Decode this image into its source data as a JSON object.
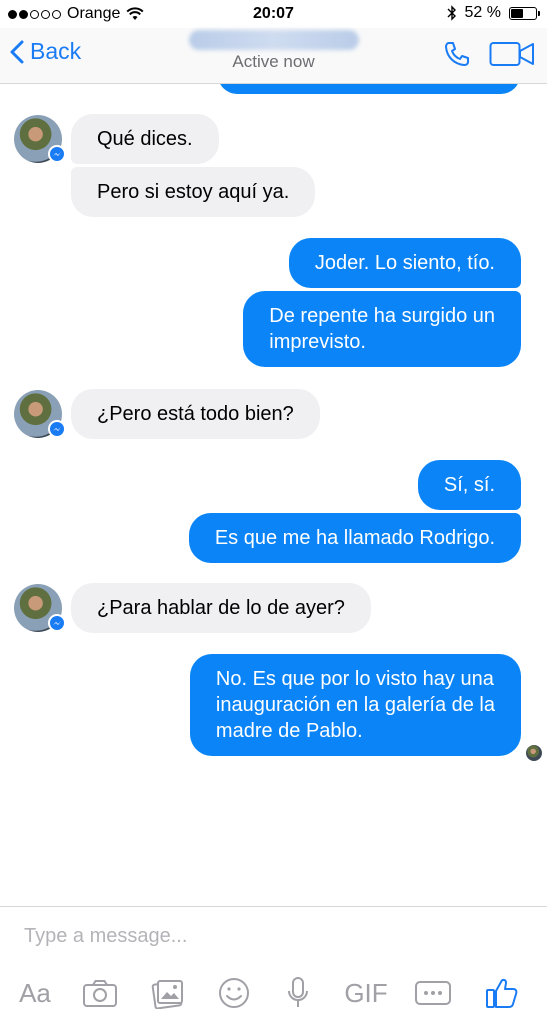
{
  "status_bar": {
    "carrier": "Orange",
    "time": "20:07",
    "battery": "52 %",
    "battery_level": 0.52
  },
  "nav": {
    "back_label": "Back",
    "subtitle": "Active now"
  },
  "messages": [
    {
      "text": "Qué dices."
    },
    {
      "text": "Pero si estoy aquí ya."
    },
    {
      "text": "Joder. Lo siento, tío."
    },
    {
      "text": "De repente ha surgido un\nimprevisto."
    },
    {
      "text": "¿Pero está todo bien?"
    },
    {
      "text": "Sí, sí."
    },
    {
      "text": "Es que me ha llamado Rodrigo."
    },
    {
      "text": "¿Para hablar de lo de ayer?"
    },
    {
      "text": "No. Es que por lo visto hay una\ninauguración en la galería de la\nmadre de Pablo."
    }
  ],
  "composer": {
    "placeholder": "Type a message...",
    "toolbar": {
      "text_label": "Aa",
      "gif_label": "GIF"
    }
  },
  "colors": {
    "accent": "#1a7cf5",
    "outgoing_bubble": "#0a84f6",
    "incoming_bubble": "#f0f0f2"
  }
}
